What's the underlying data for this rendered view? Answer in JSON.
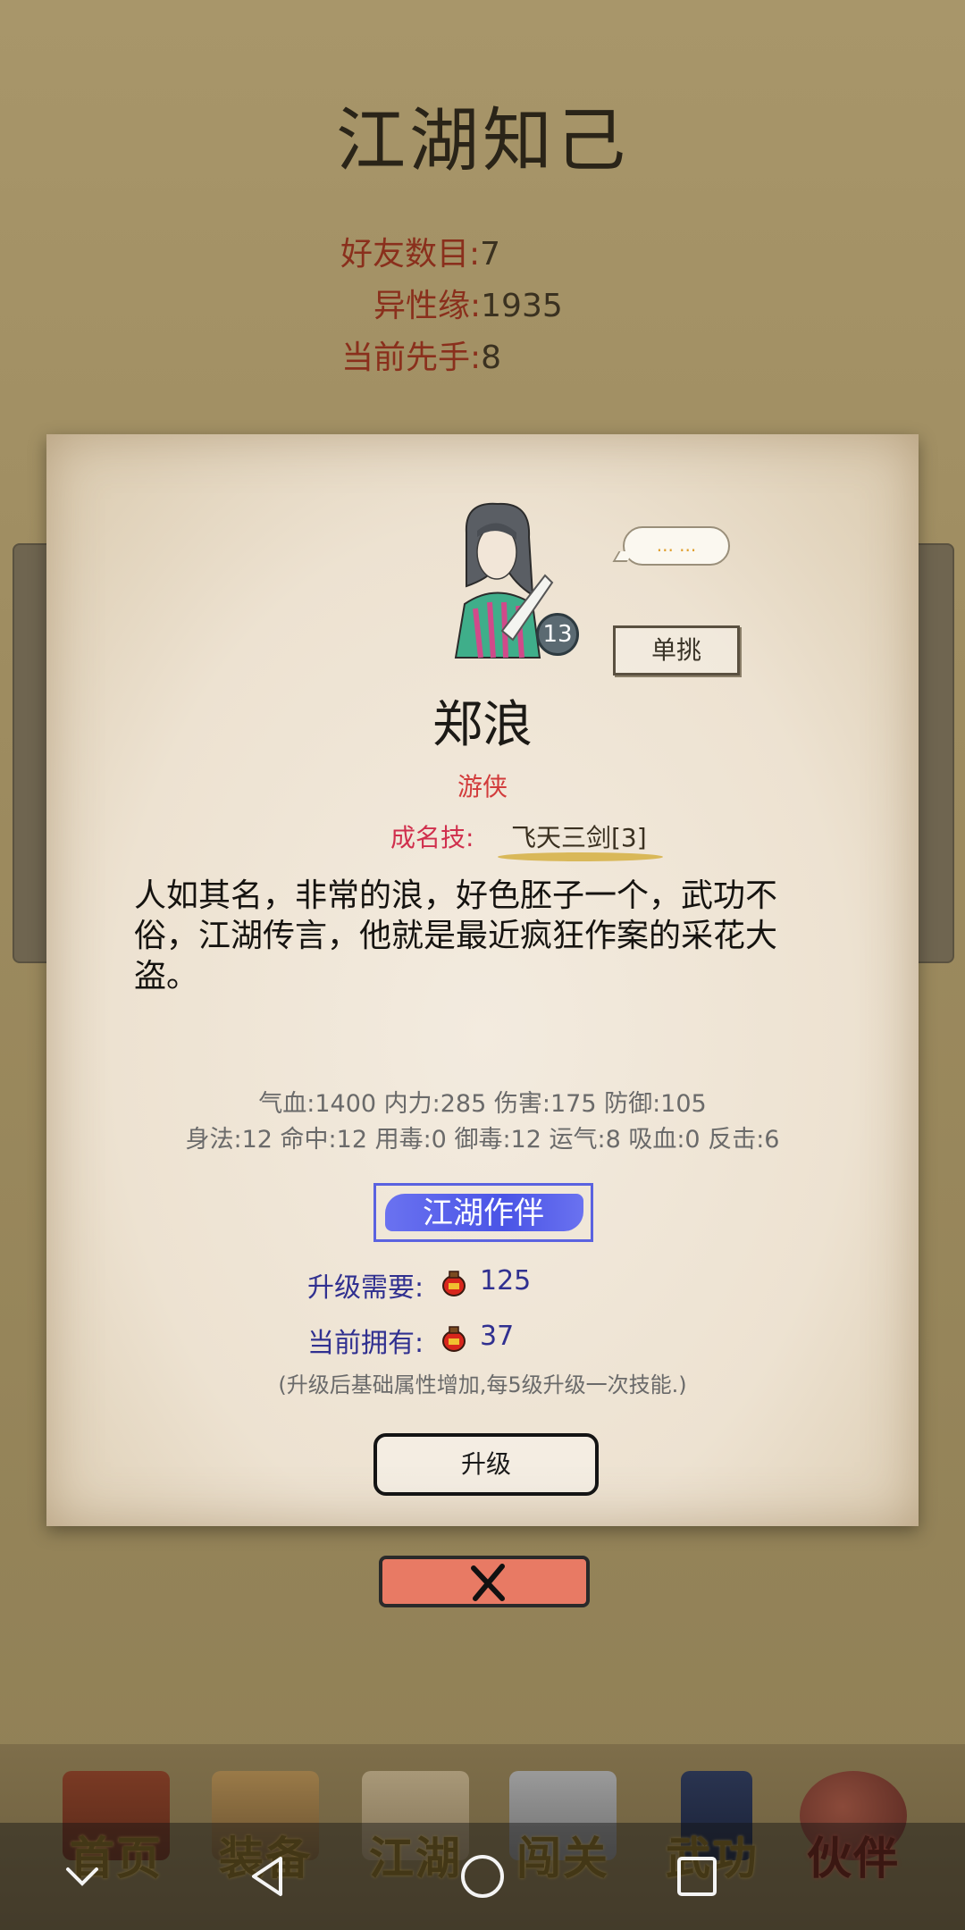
{
  "page": {
    "title": "江湖知己",
    "stats": [
      {
        "key": "好友数目:",
        "value": "7"
      },
      {
        "key": "异性缘:",
        "value": "1935"
      },
      {
        "key": "当前先手:",
        "value": "8"
      }
    ]
  },
  "card": {
    "level": "13",
    "speech": "... ...",
    "duel_label": "单挑",
    "name": "郑浪",
    "class": "游侠",
    "skill_label": "成名技:",
    "skill_name": "飞天三剑[3]",
    "description": "人如其名，非常的浪，好色胚子一个，武功不俗，江湖传言，他就是最近疯狂作案的采花大盗。",
    "attributes_line1": "气血:1400  内力:285  伤害:175  防御:105",
    "attributes_line2": "身法:12  命中:12  用毒:0  御毒:12  运气:8  吸血:0  反击:6",
    "partner_tag": "江湖作伴",
    "upgrade_need_label": "升级需要:",
    "upgrade_need_value": "125",
    "current_have_label": "当前拥有:",
    "current_have_value": "37",
    "hint": "(升级后基础属性增加,每5级升级一次技能.)",
    "upgrade_label": "升级"
  },
  "tabs": [
    {
      "label": "首页",
      "icon": "building-icon"
    },
    {
      "label": "装备",
      "icon": "armor-icon"
    },
    {
      "label": "江湖",
      "icon": "scroll-map-icon"
    },
    {
      "label": "闯关",
      "icon": "crossed-swords-icon"
    },
    {
      "label": "武功",
      "icon": "book-icon"
    },
    {
      "label": "伙伴",
      "icon": "companions-icon",
      "active": true
    }
  ],
  "colors": {
    "accent_blue": "#4a54e6",
    "stat_key": "#8a2f1c",
    "close_button": "#e87a64"
  }
}
